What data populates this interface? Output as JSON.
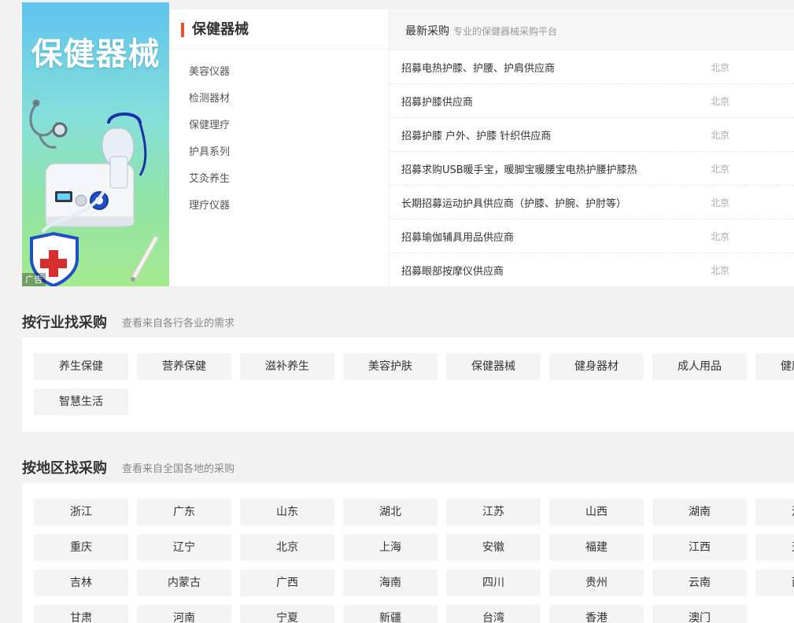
{
  "banner": {
    "title": "保健器械",
    "ad_label": "广告"
  },
  "category": {
    "title": "保健器械",
    "items": [
      "美容仪器",
      "检测器材",
      "保健理疗",
      "护具系列",
      "艾灸养生",
      "理疗仪器"
    ]
  },
  "news": {
    "title": "最新采购",
    "subtitle": "专业的保健器械采购平台",
    "rows": [
      {
        "text": "招募电热护膝、护腰、护肩供应商",
        "city": "北京"
      },
      {
        "text": "招募护膝供应商",
        "city": "北京"
      },
      {
        "text": "招募护膝 户外、护膝 针织供应商",
        "city": "北京"
      },
      {
        "text": "招募求购USB暖手宝，暖脚宝暖腰宝电热护腰护膝热",
        "city": "北京"
      },
      {
        "text": "长期招募运动护具供应商（护膝、护腕、护肘等）",
        "city": "北京"
      },
      {
        "text": "招募瑜伽辅具用品供应商",
        "city": "北京"
      },
      {
        "text": "招募眼部按摩仪供应商",
        "city": "北京"
      }
    ]
  },
  "industry": {
    "title": "按行业找采购",
    "subtitle": "查看来自各行各业的需求",
    "tags": [
      "养生保健",
      "营养保健",
      "滋补养生",
      "美容护肤",
      "保健器械",
      "健身器材",
      "成人用品",
      "健康",
      "智慧生活"
    ]
  },
  "region": {
    "title": "按地区找采购",
    "subtitle": "查看来自全国各地的采购",
    "tags": [
      "浙江",
      "广东",
      "山东",
      "湖北",
      "江苏",
      "山西",
      "湖南",
      "河",
      "重庆",
      "辽宁",
      "北京",
      "上海",
      "安徽",
      "福建",
      "江西",
      "天",
      "吉林",
      "内蒙古",
      "广西",
      "海南",
      "四川",
      "贵州",
      "云南",
      "西",
      "甘肃",
      "河南",
      "宁夏",
      "新疆",
      "台湾",
      "香港",
      "澳门"
    ]
  },
  "colors": {
    "accent": "#e4572e",
    "page_bg": "#f2f2f2",
    "tag_bg": "#f4f4f4"
  }
}
